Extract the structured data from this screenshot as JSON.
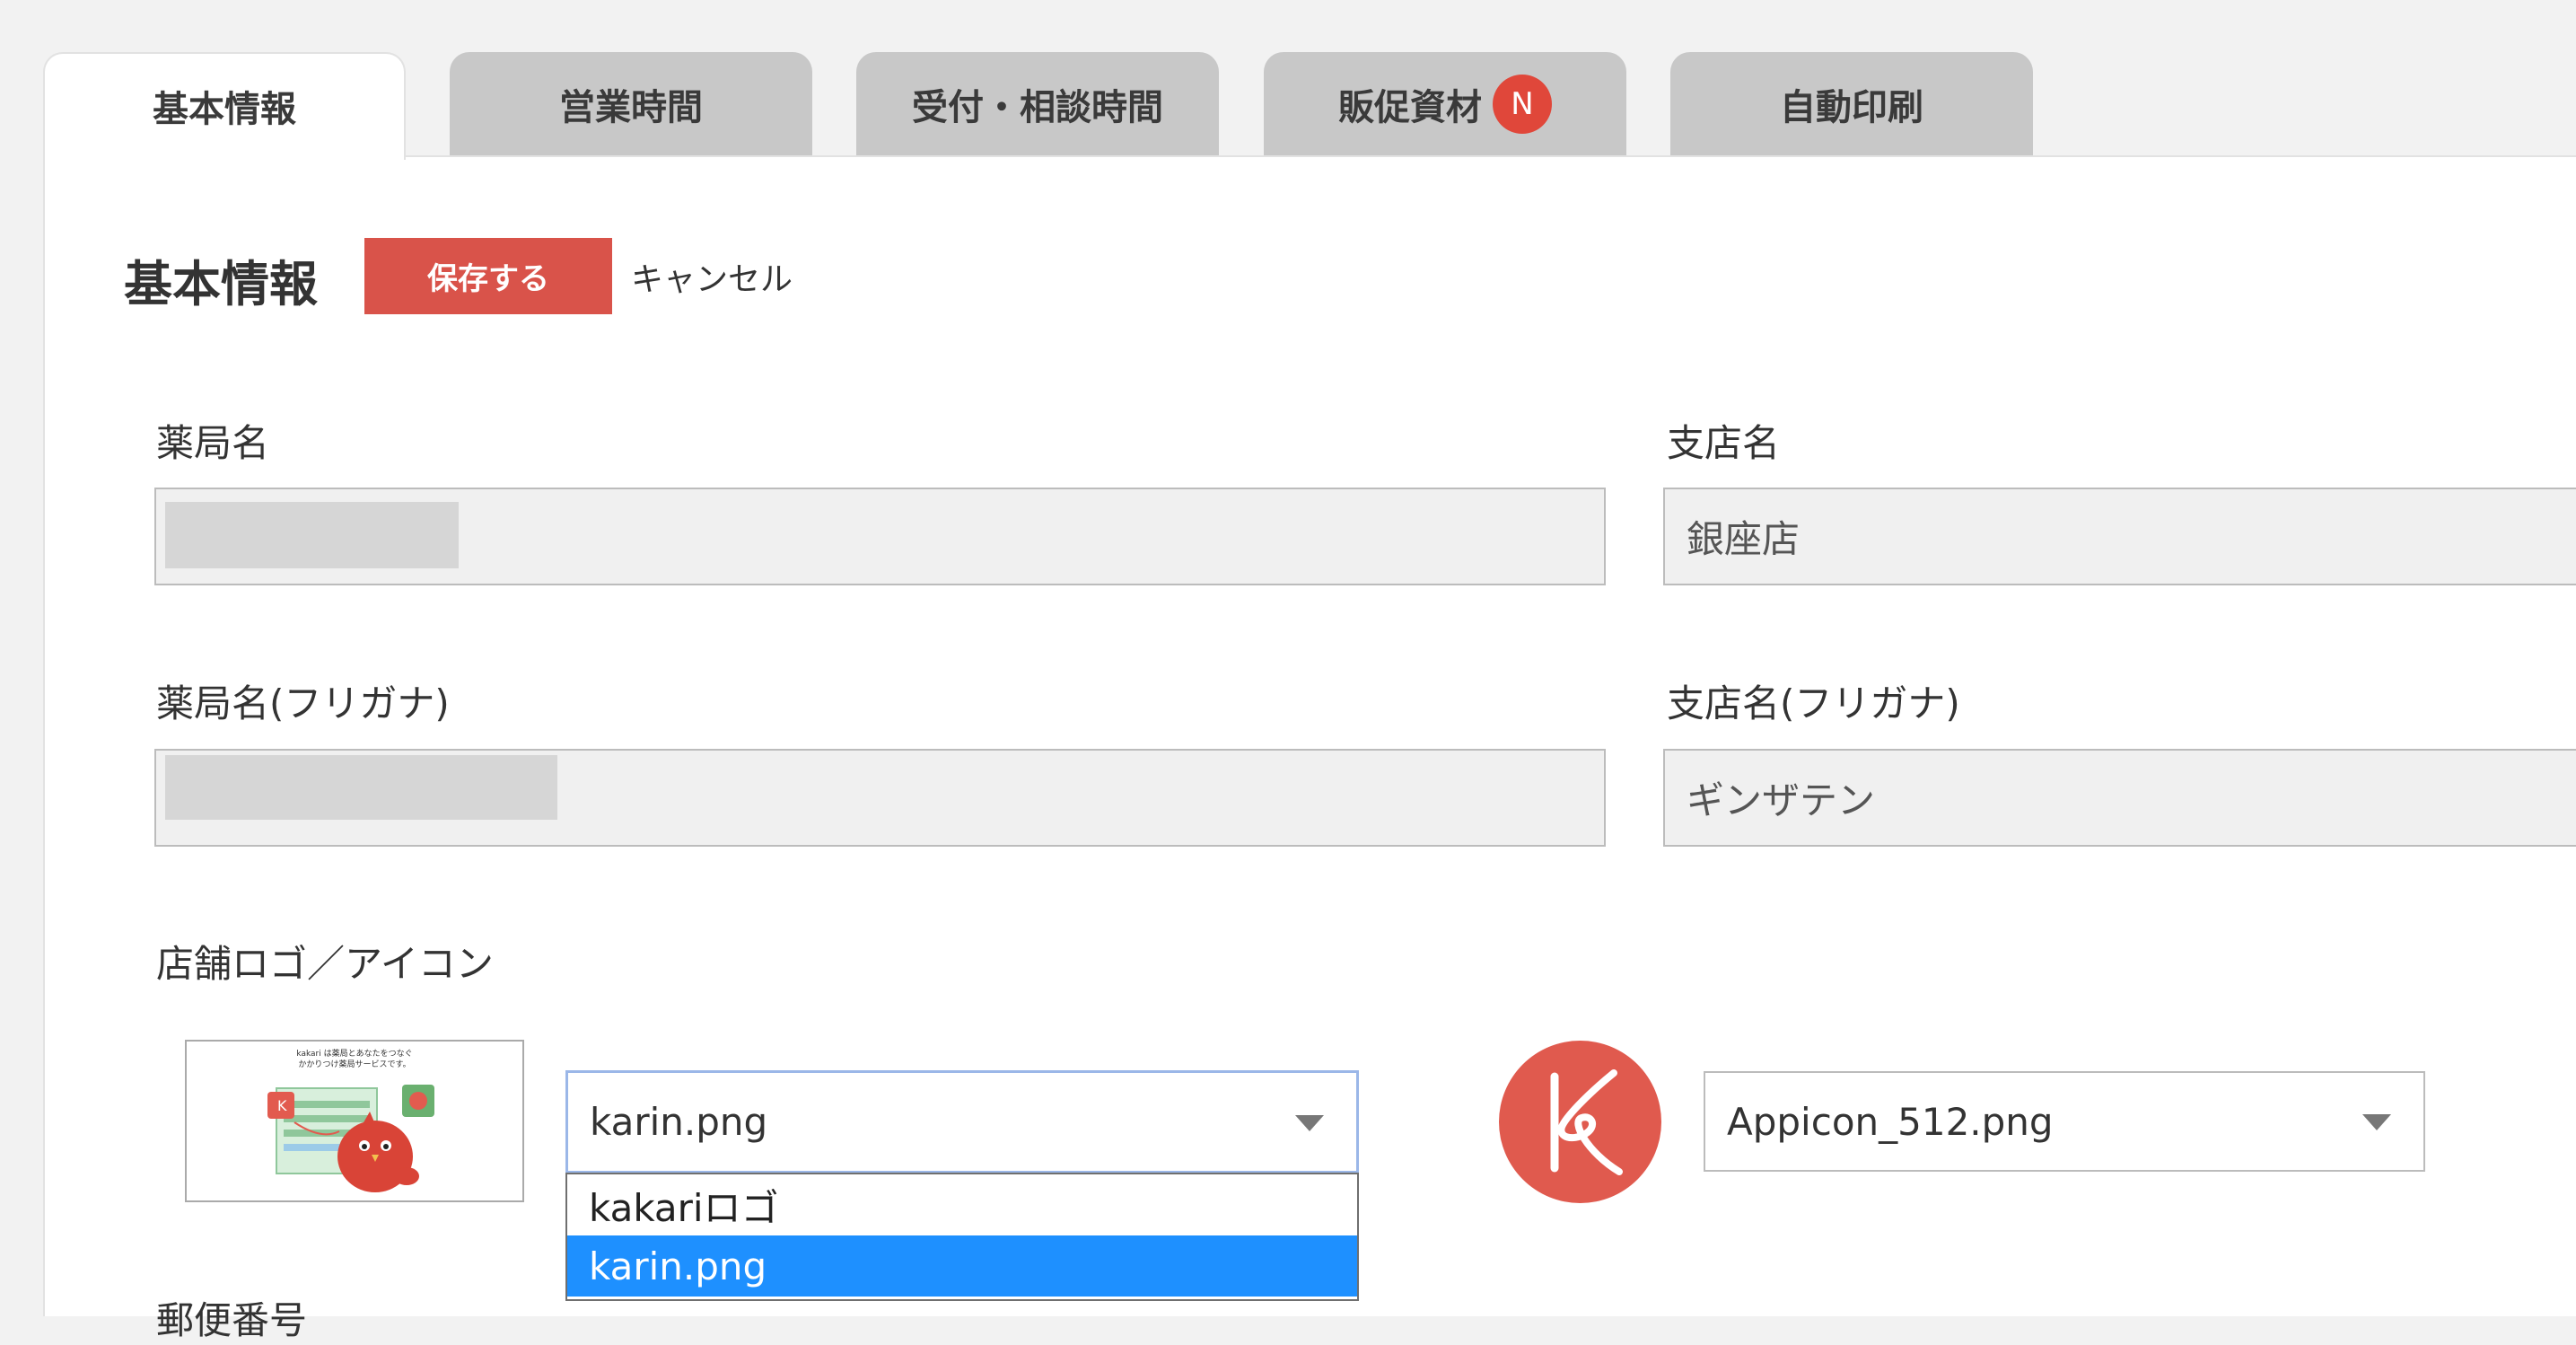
{
  "tabs": [
    {
      "label": "基本情報",
      "active": true
    },
    {
      "label": "営業時間",
      "active": false
    },
    {
      "label": "受付・相談時間",
      "active": false
    },
    {
      "label": "販促資材",
      "active": false,
      "badge": "N"
    },
    {
      "label": "自動印刷",
      "active": false
    }
  ],
  "header": {
    "title": "基本情報",
    "save_label": "保存する",
    "cancel_label": "キャンセル"
  },
  "form": {
    "pharmacy_name": {
      "label": "薬局名",
      "value": ""
    },
    "branch_name": {
      "label": "支店名",
      "value": "銀座店"
    },
    "pharmacy_kana": {
      "label": "薬局名(フリガナ)",
      "value": ""
    },
    "branch_kana": {
      "label": "支店名(フリガナ)",
      "value": "ギンザテン"
    },
    "logo": {
      "label": "店舗ロゴ／アイコン",
      "logo_select_value": "karin.png",
      "logo_options": [
        "kakariロゴ",
        "karin.png"
      ],
      "logo_selected_option": "karin.png",
      "icon_select_value": "Appicon_512.png",
      "thumb_text_line1": "kakari は薬局とあなたをつなぐ",
      "thumb_text_line2": "かかりつけ薬局サービスです。"
    },
    "postal_label": "郵便番号"
  },
  "colors": {
    "accent_red": "#d9534a",
    "badge_red": "#e0473a",
    "selected_blue": "#1e90ff",
    "icon_red": "#e05a4e"
  }
}
